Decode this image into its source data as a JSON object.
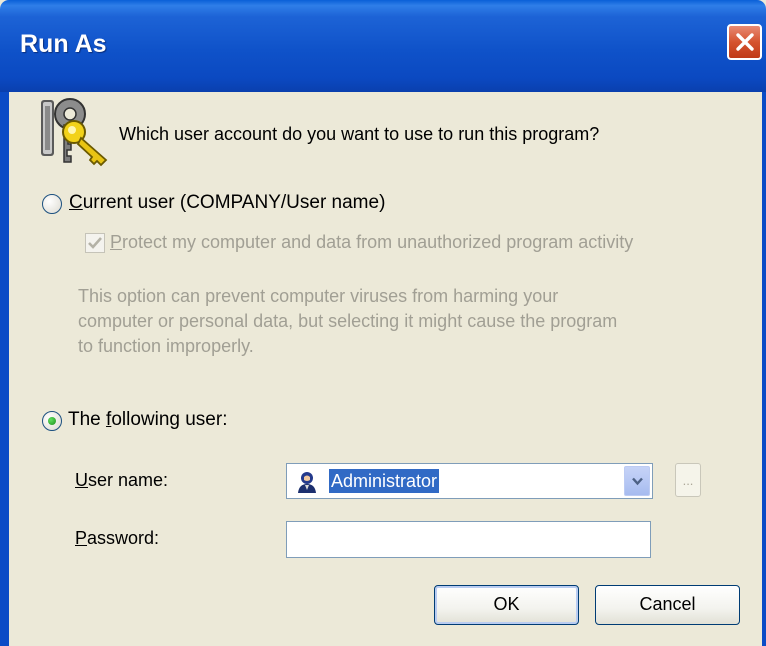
{
  "window": {
    "title": "Run As",
    "close_icon": "close-icon"
  },
  "header": {
    "icon": "keys-icon",
    "prompt": "Which user account do you want to use to run this program?"
  },
  "current_user": {
    "label_underlined": "C",
    "label_rest": "urrent user (COMPANY/User name)",
    "selected": false,
    "protect_checkbox": {
      "label_underlined": "P",
      "label_rest": "rotect my computer and data from unauthorized program activity",
      "checked": true,
      "enabled": false
    },
    "description_lines": [
      "This option can prevent computer viruses from harming your",
      "computer or personal data, but selecting it might cause the program",
      "to function improperly."
    ]
  },
  "following_user": {
    "label_before": "The ",
    "label_underlined": "f",
    "label_rest": "ollowing user:",
    "selected": true,
    "username": {
      "label_underlined": "U",
      "label_rest": "ser name:",
      "value": "Administrator",
      "icon": "user-icon",
      "browse_label": "..."
    },
    "password": {
      "label_underlined": "P",
      "label_rest": "assword:",
      "value": ""
    }
  },
  "buttons": {
    "ok": "OK",
    "cancel": "Cancel"
  }
}
